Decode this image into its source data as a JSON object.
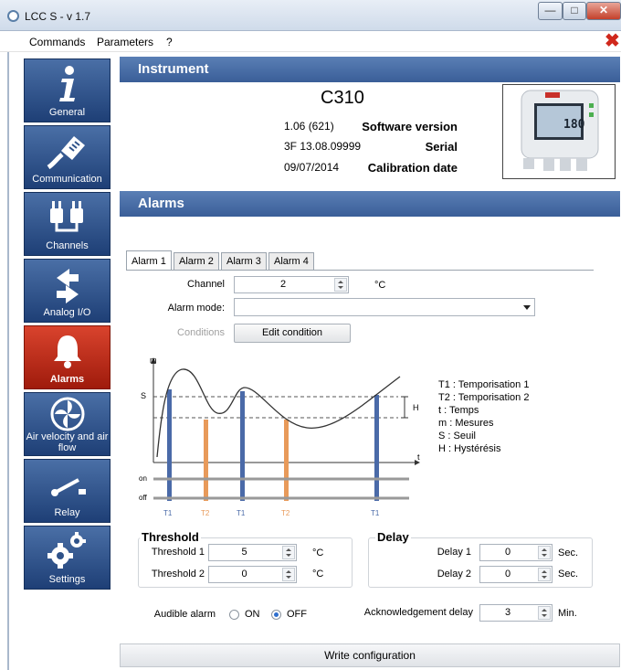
{
  "window": {
    "title": "LCC S - v 1.7",
    "min_glyph": "—",
    "max_glyph": "□",
    "close_glyph": "✕"
  },
  "menu": {
    "items": [
      "Commands",
      "Parameters",
      "?"
    ],
    "close_glyph": "✖"
  },
  "sidebar": {
    "items": [
      {
        "label": "General",
        "icon": "info-icon"
      },
      {
        "label": "Communication",
        "icon": "rj45-plug-icon"
      },
      {
        "label": "Channels",
        "icon": "plugs-icon"
      },
      {
        "label": "Analog I/O",
        "icon": "arrows-icon"
      },
      {
        "label": "Alarms",
        "icon": "bell-icon"
      },
      {
        "label": "Air velocity and air flow",
        "icon": "fan-icon"
      },
      {
        "label": "Relay",
        "icon": "switch-icon"
      },
      {
        "label": "Settings",
        "icon": "gears-icon"
      }
    ],
    "active": "Alarms",
    "colors": {
      "normal": "#2e5289",
      "active": "#c42f1c"
    }
  },
  "instrument": {
    "header": "Instrument",
    "model": "C310",
    "rows": [
      {
        "label": "Software version",
        "value": "1.06 (621)"
      },
      {
        "label": "Serial",
        "value": "3F 13.08.09999"
      },
      {
        "label": "Calibration date",
        "value": "09/07/2014"
      }
    ],
    "photo_reading": "180"
  },
  "alarms": {
    "header": "Alarms",
    "tabs": [
      "Alarm 1",
      "Alarm 2",
      "Alarm 3",
      "Alarm 4"
    ],
    "active_tab": "Alarm 1",
    "channel": {
      "label": "Channel",
      "value": "2",
      "unit": "°C"
    },
    "alarm_mode": {
      "label": "Alarm mode:",
      "value": ""
    },
    "conditions": {
      "label": "Conditions",
      "button": "Edit condition"
    },
    "diagram": {
      "axis_m": "m",
      "axis_t": "t",
      "level_s": "S",
      "level_h": "H",
      "on": "on",
      "off": "off",
      "markers": [
        "T1",
        "T2",
        "T1",
        "T2",
        "T1"
      ],
      "colors": {
        "t1": "#4a6aa8",
        "t2": "#e89a5a",
        "curve": "#333333"
      }
    },
    "legend": [
      "T1 : Temporisation 1",
      "T2 : Temporisation 2",
      "t : Temps",
      "m : Mesures",
      "S : Seuil",
      "H : Hystérésis"
    ],
    "threshold": {
      "title": "Threshold",
      "rows": [
        {
          "label": "Threshold 1",
          "value": "5",
          "unit": "°C"
        },
        {
          "label": "Threshold 2",
          "value": "0",
          "unit": "°C"
        }
      ]
    },
    "delay": {
      "title": "Delay",
      "rows": [
        {
          "label": "Delay 1",
          "value": "0",
          "unit": "Sec."
        },
        {
          "label": "Delay 2",
          "value": "0",
          "unit": "Sec."
        }
      ]
    },
    "audible": {
      "label": "Audible alarm",
      "on": "ON",
      "off": "OFF",
      "selected": "OFF"
    },
    "ack": {
      "label": "Acknowledgement delay",
      "value": "3",
      "unit": "Min."
    }
  },
  "write_button": "Write configuration"
}
